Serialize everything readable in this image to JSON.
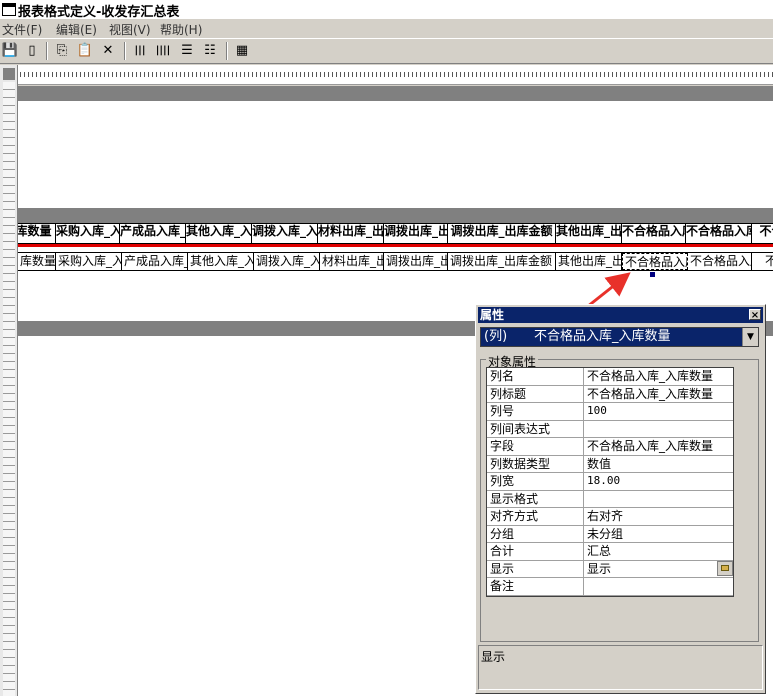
{
  "window": {
    "title": "报表格式定义-收发存汇总表"
  },
  "menu": [
    {
      "label": "文件(F)"
    },
    {
      "label": "编辑(E)"
    },
    {
      "label": "视图(V)"
    },
    {
      "label": "帮助(H)"
    }
  ],
  "toolbar": {
    "buttons": [
      {
        "icon": "save-icon",
        "glyph": "💾"
      },
      {
        "icon": "page-setup-icon",
        "glyph": "▯"
      },
      {
        "icon": "copy-icon",
        "glyph": "⎘"
      },
      {
        "icon": "paste-icon",
        "glyph": "📋"
      },
      {
        "icon": "delete-icon",
        "glyph": "✕"
      },
      {
        "icon": "column-insert-icon",
        "glyph": "|||"
      },
      {
        "icon": "column-adjust-icon",
        "glyph": "||||"
      },
      {
        "icon": "align-left-icon",
        "glyph": "☰"
      },
      {
        "icon": "align-right-icon",
        "glyph": "☷"
      },
      {
        "icon": "properties-icon",
        "glyph": "▦"
      }
    ]
  },
  "report": {
    "header_cells": [
      "库数量",
      "采购入库_入库件数",
      "产成品入库_入库件数",
      "其他入库_入库件数",
      "调拨入库_入库件数",
      "材料出库_出库件数",
      "调拨出库_出库件数",
      "调拨出库_出库金额",
      "其他出库_出库件数",
      "不合格品入库_入库件数",
      "不合格品入库_入库件数",
      "不合"
    ],
    "data_cells": [
      "库数量",
      "采购入库_入库件数",
      "产成品入库_入库件数",
      "其他入库_入库件数",
      "调拨入库_入库件数",
      "材料出库_出库件数",
      "调拨出库_出库件数",
      "调拨出库_出库金额",
      "其他出库_出库件数",
      "不合格品入库_入库件数",
      "不合格品入库_入库件数",
      "不合"
    ]
  },
  "properties_panel": {
    "title": "属性",
    "close_glyph": "×",
    "selector_prefix": "(列)",
    "selector_value": "不合格品入库_入库数量",
    "group_label": "对象属性",
    "rows": [
      {
        "key": "列名",
        "value": "不合格品入库_入库数量"
      },
      {
        "key": "列标题",
        "value": "不合格品入库_入库数量"
      },
      {
        "key": "列号",
        "value": "100"
      },
      {
        "key": "列间表达式",
        "value": ""
      },
      {
        "key": "字段",
        "value": "不合格品入库_入库数量"
      },
      {
        "key": "列数据类型",
        "value": "数值"
      },
      {
        "key": "列宽",
        "value": "18.00"
      },
      {
        "key": "显示格式",
        "value": ""
      },
      {
        "key": "对齐方式",
        "value": "右对齐"
      },
      {
        "key": "分组",
        "value": "未分组"
      },
      {
        "key": "合计",
        "value": "汇总"
      },
      {
        "key": "显示",
        "value": "显示"
      },
      {
        "key": "备注",
        "value": ""
      }
    ],
    "description": "显示"
  }
}
